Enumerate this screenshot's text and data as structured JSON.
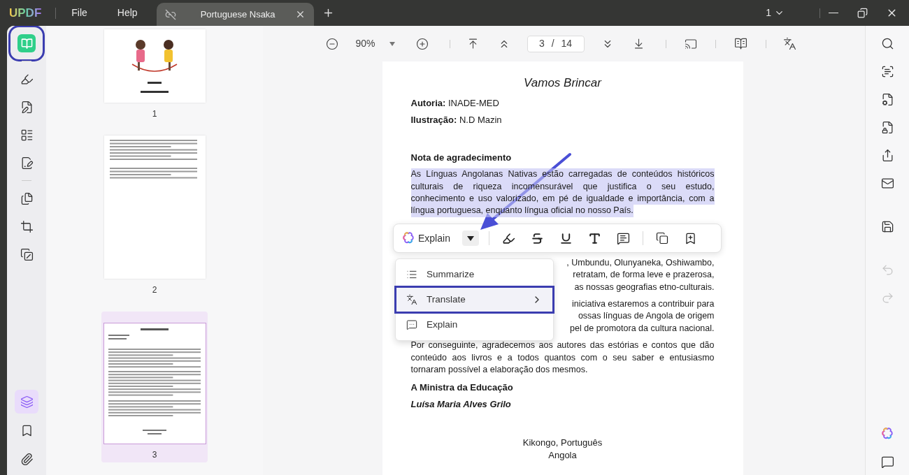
{
  "app": {
    "logo": "UPDF",
    "menus": [
      "File",
      "Help"
    ]
  },
  "tabs": [
    {
      "title": "Portuguese Nsaka",
      "selected": true
    }
  ],
  "window": {
    "account": "1"
  },
  "left_tools": [
    {
      "kind": "reader",
      "selected": true
    },
    {
      "kind": "highlighter",
      "selected": false
    },
    {
      "kind": "edit",
      "selected": false
    },
    {
      "kind": "form",
      "selected": false
    },
    {
      "kind": "fill",
      "selected": false
    },
    {
      "kind": "pages",
      "selected": false
    },
    {
      "kind": "crop",
      "selected": false
    },
    {
      "kind": "stamp",
      "selected": false
    }
  ],
  "bottom_tools": [
    {
      "kind": "layers",
      "selected": true
    },
    {
      "kind": "bookmark",
      "selected": false
    },
    {
      "kind": "attachment",
      "selected": false
    }
  ],
  "thumbnails": [
    {
      "number": "1",
      "selected": false,
      "kind": "cover"
    },
    {
      "number": "2",
      "selected": false,
      "kind": "credits"
    },
    {
      "number": "3",
      "selected": true,
      "kind": "text"
    }
  ],
  "toolbar": {
    "zoom": "90%",
    "page": "3",
    "separator": "/",
    "total": "14"
  },
  "document": {
    "title": "Vamos Brincar",
    "meta": [
      {
        "label": "Autoria:",
        "value": "INADE-MED"
      },
      {
        "label": "Ilustração:",
        "value": "N.D Mazin"
      }
    ],
    "heading": "Nota de agradecimento",
    "highlighted_lines": [
      "As Línguas Angolanas Nativas estão carregadas de conteúdos históricos",
      "culturais de riqueza incomensurável que justifica o seu estudo,",
      "conhecimento e uso valorizado, em pé de igualdade e importância, com a",
      "língua portuguesa, enquanto língua oficial no nosso País."
    ],
    "fragment_paragraphs": [
      [
        ", Umbundu, Olunyaneka, Oshiwambo,",
        "retratam, de forma leve e prazerosa,",
        "as nossas geografias etno-culturais."
      ],
      [
        "iniciativa estaremos a contribuir para",
        "ossas línguas de Angola de origem",
        "pel de promotora da cultura nacional."
      ]
    ],
    "closing_lines": [
      "Por conseguinte, agradecemos aos autores das estórias e contos que dão",
      "conteúdo aos livros e a todos quantos com o seu saber e entusiasmo",
      "tornaram possível a elaboração dos mesmos."
    ],
    "signature_title": "A Ministra da Educação",
    "signature_name": "Luísa Maria Alves Grilo",
    "footer": [
      "Kikongo, Português",
      "Angola"
    ]
  },
  "selection_toolbar": {
    "ai_label": "Explain"
  },
  "context_menu": [
    {
      "label": "Summarize",
      "kind": "summarize",
      "selected": false,
      "submenu": false
    },
    {
      "label": "Translate",
      "kind": "translate",
      "selected": true,
      "submenu": true
    },
    {
      "label": "Explain",
      "kind": "explain",
      "selected": false,
      "submenu": false
    }
  ],
  "right_tools": [
    {
      "kind": "search",
      "disabled": false
    },
    {
      "kind": "ocr",
      "disabled": false
    },
    {
      "kind": "convert",
      "disabled": false
    },
    {
      "kind": "protect",
      "disabled": false
    },
    {
      "kind": "share",
      "disabled": false
    },
    {
      "kind": "mail",
      "disabled": false
    },
    {
      "kind": "save",
      "disabled": false
    },
    {
      "kind": "undo",
      "disabled": true
    },
    {
      "kind": "redo",
      "disabled": true
    }
  ],
  "right_bottom_tools": [
    {
      "kind": "ai",
      "disabled": false
    },
    {
      "kind": "comment",
      "disabled": false
    }
  ]
}
